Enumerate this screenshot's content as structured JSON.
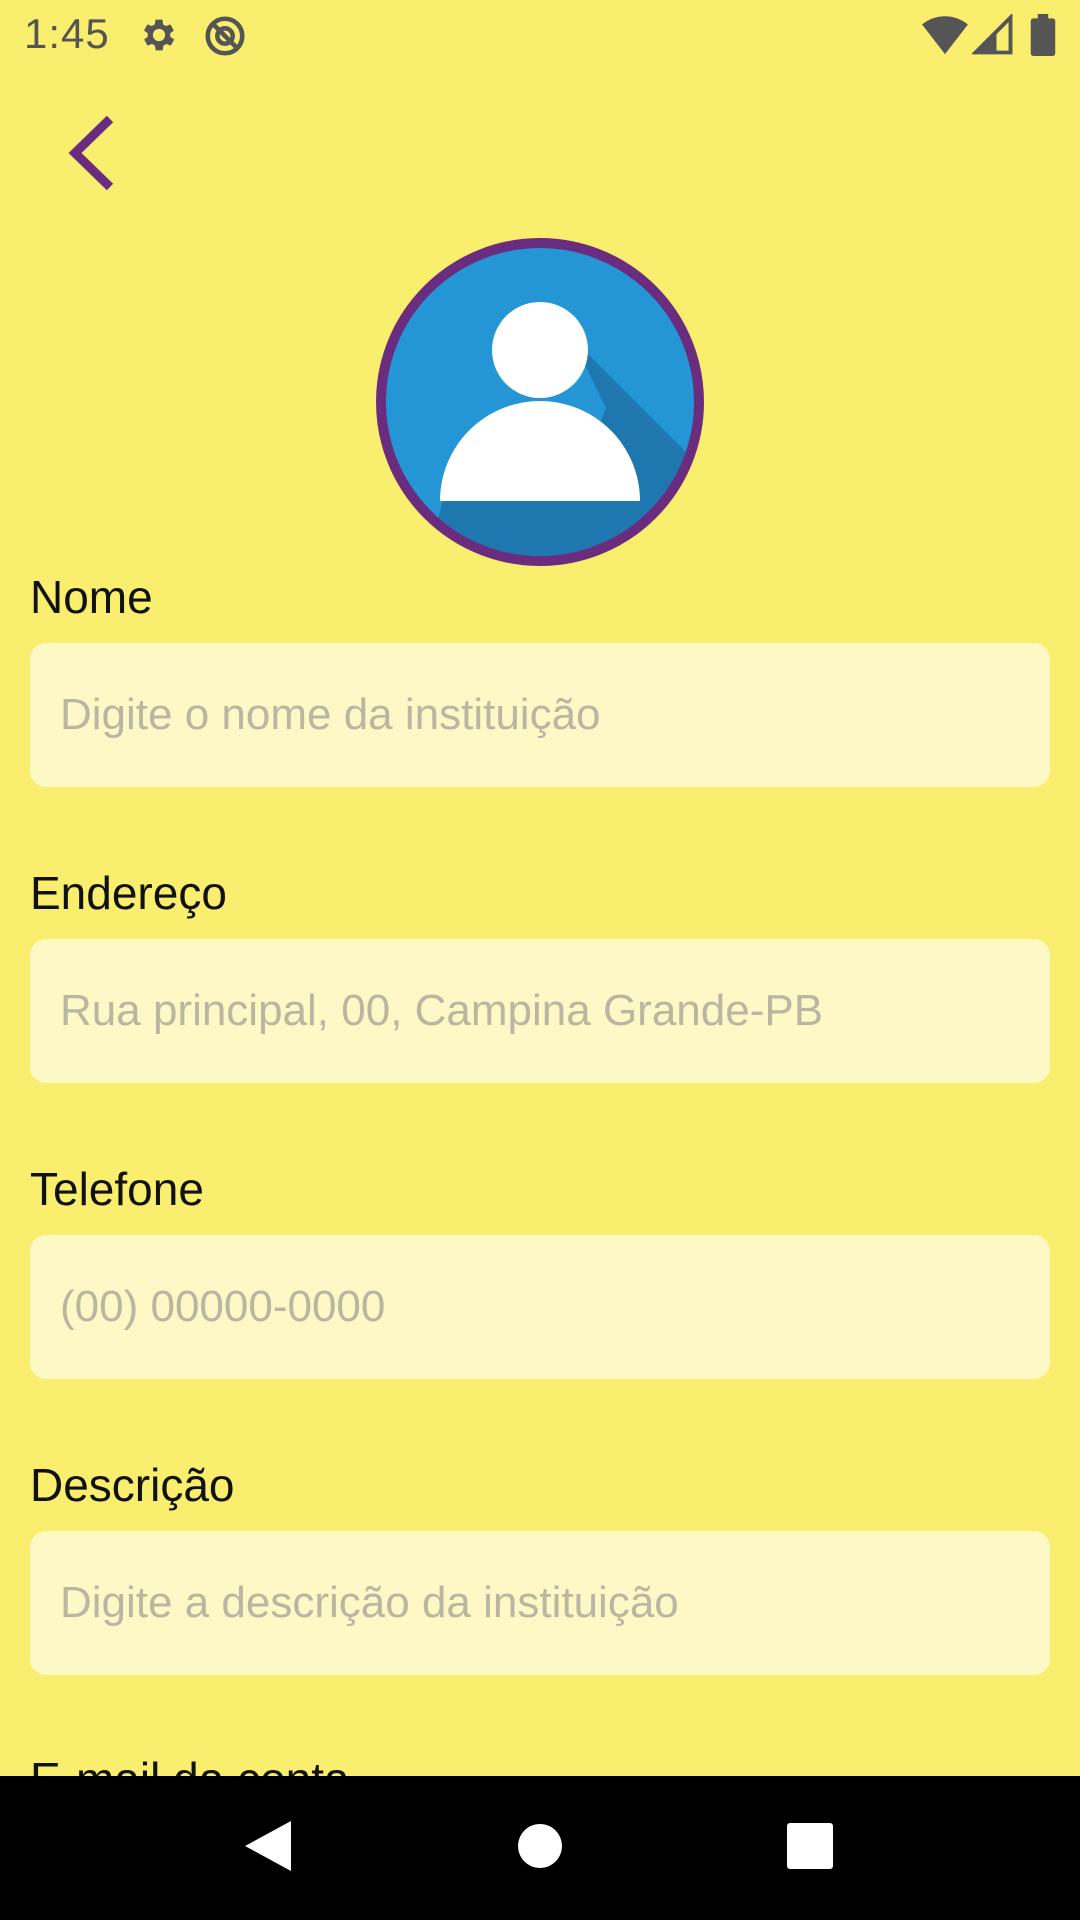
{
  "status_bar": {
    "time": "1:45",
    "icons": [
      "gear-icon",
      "no-data-icon",
      "wifi-icon",
      "signal-icon",
      "battery-icon"
    ]
  },
  "header": {
    "back_icon": "chevron-left-icon"
  },
  "avatar": {
    "icon": "user-avatar-icon",
    "border_color": "#6A2C7E",
    "fill_color": "#2496D6"
  },
  "form": {
    "fields": [
      {
        "label": "Nome",
        "placeholder": "Digite o nome da instituição",
        "value": ""
      },
      {
        "label": "Endereço",
        "placeholder": "Rua principal, 00, Campina Grande-PB",
        "value": ""
      },
      {
        "label": "Telefone",
        "placeholder": "(00) 00000-0000",
        "value": ""
      },
      {
        "label": "Descrição",
        "placeholder": "Digite a descrição da instituição",
        "value": ""
      }
    ],
    "next_label_partial": "E-mail da conta"
  },
  "nav_bar": {
    "back_icon": "nav-back-icon",
    "home_icon": "nav-home-icon",
    "recents_icon": "nav-recents-icon"
  },
  "colors": {
    "background": "#F9EE6D",
    "input_bg": "#FCF9C6",
    "accent": "#6A2C7E"
  }
}
